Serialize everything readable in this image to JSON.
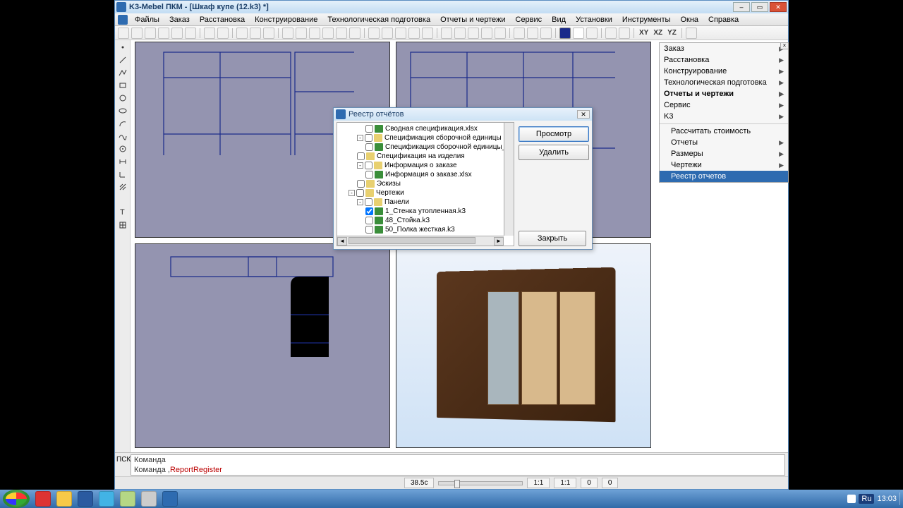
{
  "window": {
    "title": "K3-Mebel ПКМ - [Шкаф купе (12.k3) *]"
  },
  "menu": [
    "Файлы",
    "Заказ",
    "Расстановка",
    "Конструирование",
    "Технологическая подготовка",
    "Отчеты и чертежи",
    "Сервис",
    "Вид",
    "Установки",
    "Инструменты",
    "Окна",
    "Справка"
  ],
  "axis_labels": [
    "XY",
    "XZ",
    "YZ"
  ],
  "right_panel": {
    "top": [
      {
        "label": "Заказ",
        "arrow": true
      },
      {
        "label": "Расстановка",
        "arrow": true
      },
      {
        "label": "Конструирование",
        "arrow": true
      },
      {
        "label": "Технологическая подготовка",
        "arrow": true
      },
      {
        "label": "Отчеты и чертежи",
        "arrow": true,
        "bold": true
      },
      {
        "label": "Сервис",
        "arrow": true
      },
      {
        "label": "K3",
        "arrow": true
      }
    ],
    "sub": [
      {
        "label": "Рассчитать стоимость",
        "arrow": false
      },
      {
        "label": "Отчеты",
        "arrow": true
      },
      {
        "label": "Размеры",
        "arrow": true
      },
      {
        "label": "Чертежи",
        "arrow": true
      },
      {
        "label": "Реестр отчетов",
        "arrow": false,
        "selected": true
      }
    ]
  },
  "modal": {
    "title": "Реестр отчётов",
    "btn_view": "Просмотр",
    "btn_delete": "Удалить",
    "btn_close": "Закрыть",
    "tree": [
      {
        "indent": 3,
        "check": false,
        "icon": "green",
        "label": "Сводная спецификация.xlsx"
      },
      {
        "indent": 2,
        "pm": "-",
        "check": false,
        "icon": "fold",
        "label": "Спецификация сборочной единицы"
      },
      {
        "indent": 3,
        "check": false,
        "icon": "green",
        "label": "Спецификация сборочной единицы_"
      },
      {
        "indent": 2,
        "check": false,
        "icon": "fold",
        "label": "Спецификация на изделия"
      },
      {
        "indent": 2,
        "pm": "-",
        "check": false,
        "icon": "fold",
        "label": "Информация о заказе"
      },
      {
        "indent": 3,
        "check": false,
        "icon": "green",
        "label": "Информация о заказе.xlsx"
      },
      {
        "indent": 2,
        "check": false,
        "icon": "fold",
        "label": "Эскизы"
      },
      {
        "indent": 1,
        "pm": "-",
        "check": false,
        "icon": "fold",
        "label": "Чертежи"
      },
      {
        "indent": 2,
        "pm": "-",
        "check": false,
        "icon": "fold",
        "label": "Панели"
      },
      {
        "indent": 3,
        "check": true,
        "icon": "green",
        "label": "1_Стенка утопленная.k3"
      },
      {
        "indent": 3,
        "check": false,
        "icon": "green",
        "label": "48_Стойка.k3"
      },
      {
        "indent": 3,
        "check": false,
        "icon": "green",
        "label": "50_Полка жесткая.k3"
      }
    ]
  },
  "command": {
    "label": "Команда",
    "line2_prefix": "Команда ,",
    "line2_cmd": "ReportRegister",
    "psk": "ПСК"
  },
  "status": {
    "zone": "38.5с",
    "r1": "1:1",
    "r2": "1:1",
    "c1": "0",
    "c2": "0"
  },
  "taskbar": {
    "lang": "Ru",
    "time": "13:03"
  }
}
